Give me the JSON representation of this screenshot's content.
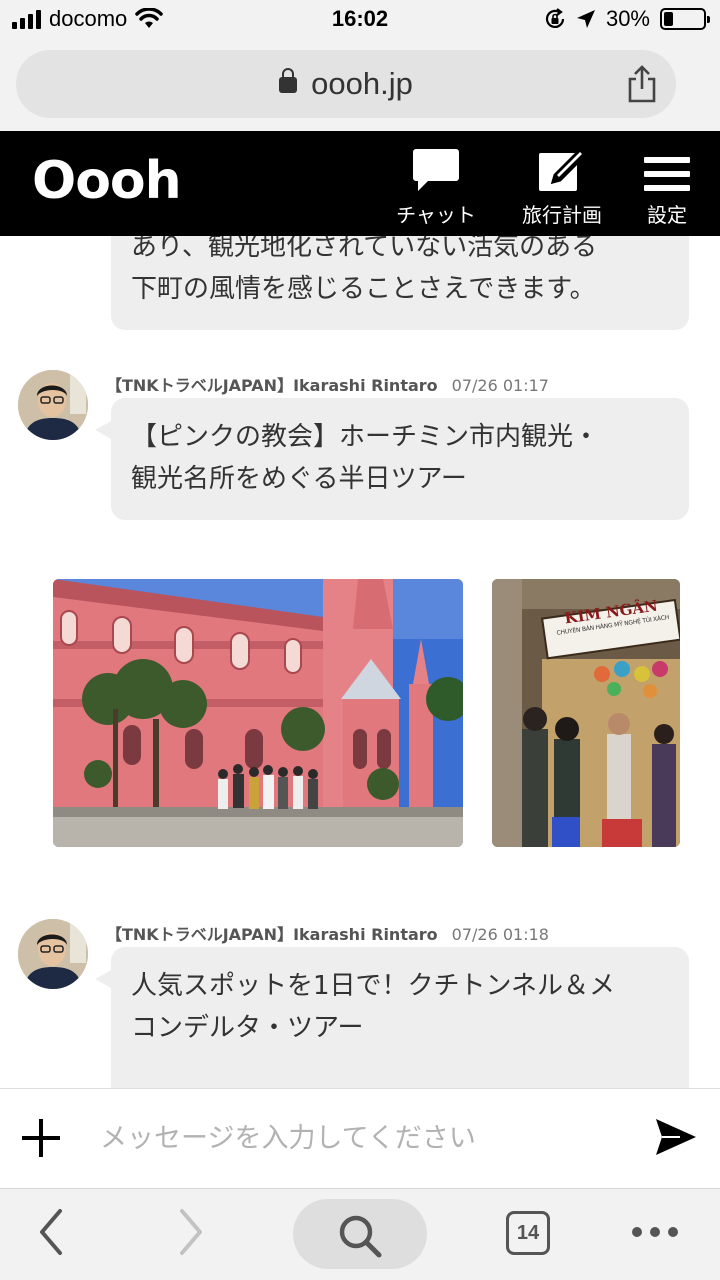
{
  "status_bar": {
    "carrier": "docomo",
    "time": "16:02",
    "battery": "30%",
    "battery_level": 0.3,
    "icons": [
      "signal-icon",
      "wifi-icon",
      "orientation-lock-icon",
      "location-icon",
      "battery-icon"
    ]
  },
  "browser": {
    "url": "oooh.jp",
    "tab_count": "14"
  },
  "app": {
    "logo": "Oooh",
    "nav": {
      "chat": "チャット",
      "plan": "旅行計画",
      "settings": "設定"
    }
  },
  "messages": {
    "prev_lines": [
      "あり、観光地化されていない活気のある",
      "下町の風情を感じることさえできます。"
    ],
    "msg1": {
      "sender": "【TNKトラベルJAPAN】Ikarashi Rintaro",
      "time": "07/26 01:17",
      "lines": [
        "【ピンクの教会】ホーチミン市内観光・",
        "観光名所をめぐる半日ツアー"
      ]
    },
    "msg2": {
      "sender": "【TNKトラベルJAPAN】Ikarashi Rintaro",
      "time": "07/26 01:18",
      "lines": [
        "人気スポットを1日で！クチトンネル＆メ",
        "コンデルタ・ツアー"
      ]
    },
    "shop_sign": {
      "line1": "KIM NGÂN",
      "line2": "CHUYÊN BÁN HÀNG MỸ NGHỆ TÚI XÁCH"
    }
  },
  "composer": {
    "placeholder": "メッセージを入力してください"
  },
  "colors": {
    "header_bg": "#000000",
    "bubble_bg": "#eeeeee",
    "church_pink": "#e0787e",
    "sky_blue": "#3b6fd1"
  }
}
